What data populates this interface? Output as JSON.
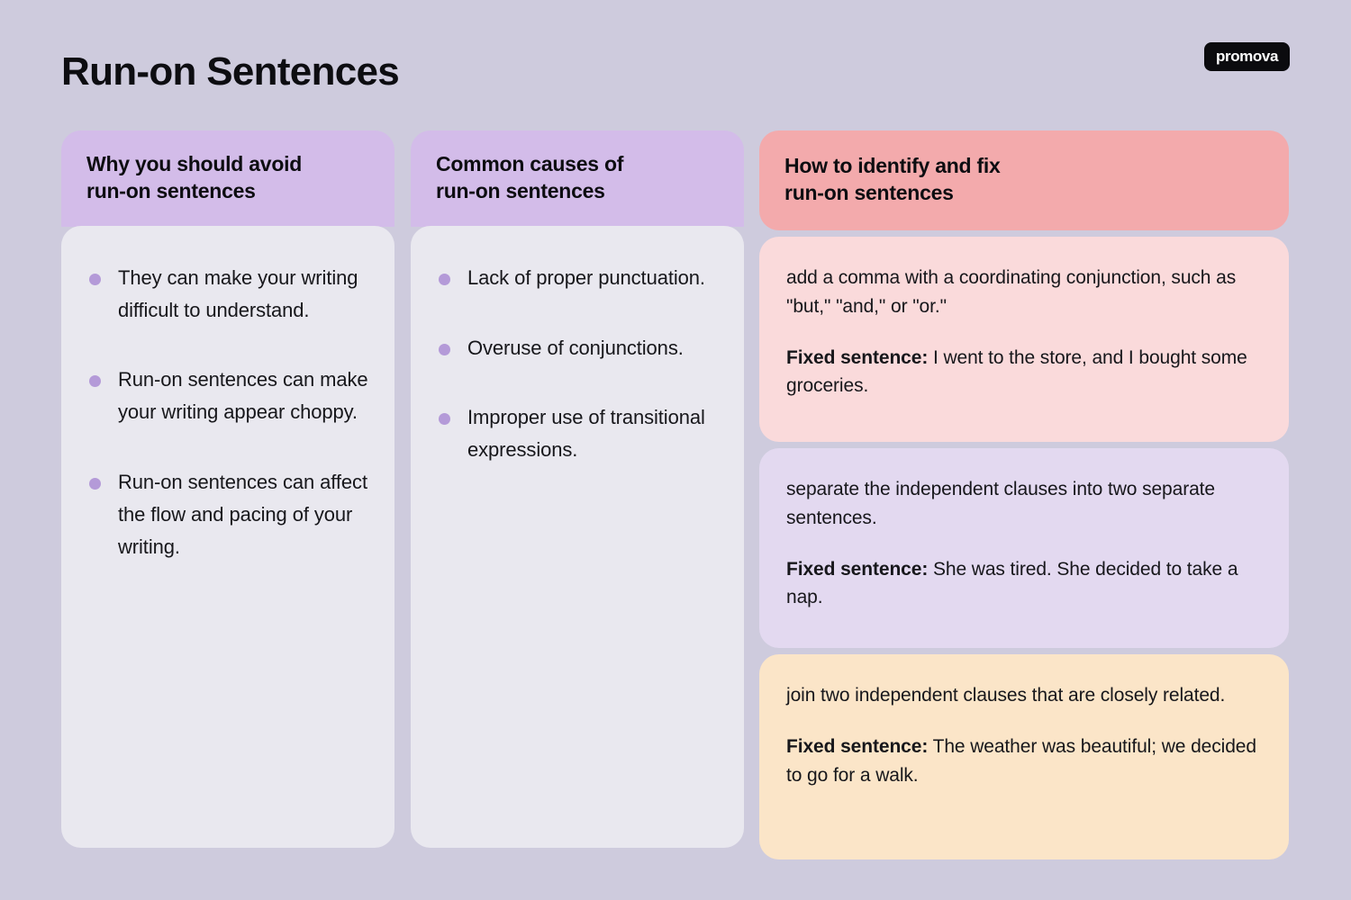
{
  "page": {
    "title": "Run-on Sentences",
    "background_color": "#cecbdd",
    "brand": "promova"
  },
  "columns": [
    {
      "id": "why-avoid",
      "header": "Why you should avoid\nrun-on sentences",
      "header_line1": "Why you should avoid",
      "header_line2": "run-on sentences",
      "header_color": "#d3bce9",
      "body_color": "#e9e8ef",
      "bullet_color": "#b49ad8",
      "items": [
        "They can make your writing difficult to understand.",
        "Run-on sentences can make your writing appear choppy.",
        "Run-on sentences can affect the flow and pacing of your writing."
      ]
    },
    {
      "id": "common-causes",
      "header": "Common causes of\nrun-on sentences",
      "header_line1": "Common causes of",
      "header_line2": "run-on sentences",
      "header_color": "#d3bce9",
      "body_color": "#e9e8ef",
      "bullet_color": "#b49ad8",
      "items": [
        "Lack of proper punctuation.",
        "Overuse of conjunctions.",
        "Improper use of transitional expressions."
      ]
    },
    {
      "id": "how-to-fix",
      "header": "How to identify and fix\nrun-on sentences",
      "header_line1": "How to identify and fix",
      "header_line2": "run-on sentences",
      "header_color": "#f3aaac",
      "cards": [
        {
          "background_color": "#fadadb",
          "description": "add a comma with a coordinating conjunction, such as \"but,\" \"and,\" or \"or.\"",
          "fixed_label": "Fixed sentence:",
          "fixed_text": " I went to the store, and I bought some groceries."
        },
        {
          "background_color": "#e3d9f0",
          "description": "separate the independent clauses into two separate sentences.",
          "fixed_label": "Fixed sentence:",
          "fixed_text": " She was tired. She decided to take a nap."
        },
        {
          "background_color": "#fbe5c8",
          "description": "join two independent clauses that are closely related.",
          "fixed_label": "Fixed sentence:",
          "fixed_text": " The weather was beautiful; we decided to go for a walk."
        }
      ]
    }
  ]
}
